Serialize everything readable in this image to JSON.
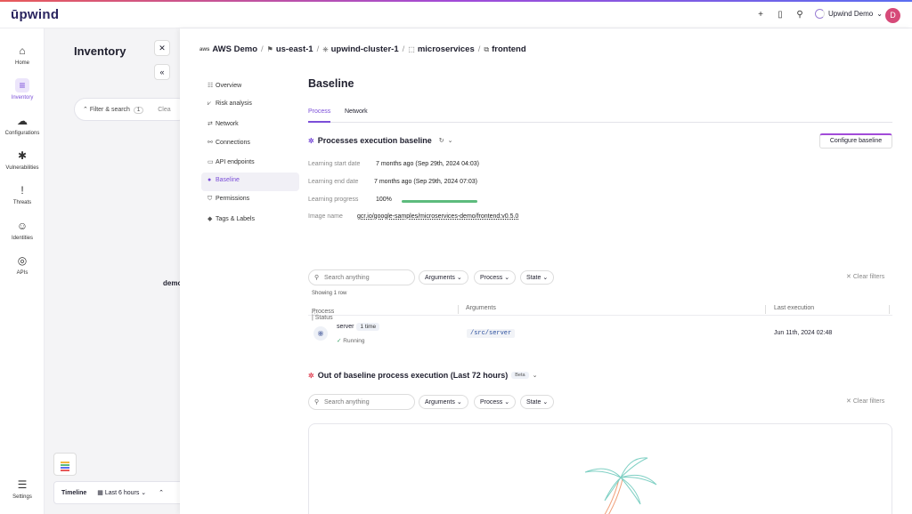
{
  "topbar": {
    "logo": "ūpwind",
    "account_name": "Upwind Demo",
    "avatar_initial": "D"
  },
  "sidebar": {
    "items": [
      {
        "label": "Home",
        "icon": "home-icon"
      },
      {
        "label": "Inventory",
        "icon": "inventory-icon"
      },
      {
        "label": "Configurations",
        "icon": "cloud-icon"
      },
      {
        "label": "Vulnerabilities",
        "icon": "bug-icon"
      },
      {
        "label": "Threats",
        "icon": "alert-icon"
      },
      {
        "label": "Identities",
        "icon": "person-icon"
      },
      {
        "label": "APIs",
        "icon": "globe-icon"
      }
    ],
    "settings_label": "Settings"
  },
  "inventory": {
    "title": "Inventory",
    "filter_label": "Filter & search",
    "filter_count": "1",
    "clear_label": "Clea",
    "demo_label": "demo",
    "timeline_label": "Timeline",
    "timeline_range": "Last 6 hours"
  },
  "breadcrumb": {
    "account_badge": "aws",
    "account": "AWS Demo",
    "region": "us-east-1",
    "cluster": "upwind-cluster-1",
    "namespace": "microservices",
    "workload": "frontend"
  },
  "subnav": [
    {
      "label": "Overview",
      "icon": "list-icon"
    },
    {
      "label": "Risk analysis",
      "icon": "chart-icon"
    },
    {
      "label": "Network",
      "icon": "arrows-icon"
    },
    {
      "label": "Connections",
      "icon": "link-icon"
    },
    {
      "label": "API endpoints",
      "icon": "api-icon"
    },
    {
      "label": "Baseline",
      "icon": "baseline-icon"
    },
    {
      "label": "Permissions",
      "icon": "shield-icon"
    },
    {
      "label": "Tags & Labels",
      "icon": "tag-icon"
    }
  ],
  "main": {
    "title": "Baseline",
    "tabs": [
      "Process",
      "Network"
    ],
    "section1_title": "Processes execution baseline",
    "configure_button": "Configure baseline",
    "details": [
      {
        "key": "Learning start date",
        "value": "7 months ago (Sep 29th, 2024 04:03)"
      },
      {
        "key": "Learning end date",
        "value": "7 months ago (Sep 29th, 2024 07:03)"
      },
      {
        "key": "Learning progress",
        "value": "100%"
      },
      {
        "key": "Image name",
        "value": "gcr.io/google-samples/microservices-demo/frontend:v0.5.0"
      }
    ],
    "learning_progress_fraction": 1.0,
    "search_placeholder": "Search anything",
    "filters": [
      "Arguments",
      "Process",
      "State"
    ],
    "clear_filters": "Clear filters",
    "showing": "Showing 1 row",
    "columns": [
      "Process | Status",
      "Arguments",
      "Last execution"
    ],
    "rows": [
      {
        "process": "server",
        "times": "1 time",
        "status": "Running",
        "arguments": "/src/server",
        "last_execution": "Jun 11th, 2024 02:48"
      }
    ],
    "section2_title": "Out of baseline process execution (Last 72 hours)",
    "beta": "Beta"
  },
  "colors": {
    "accent": "#7b4ed8",
    "progress": "#5dbb7d",
    "avatar": "#d64a79"
  }
}
